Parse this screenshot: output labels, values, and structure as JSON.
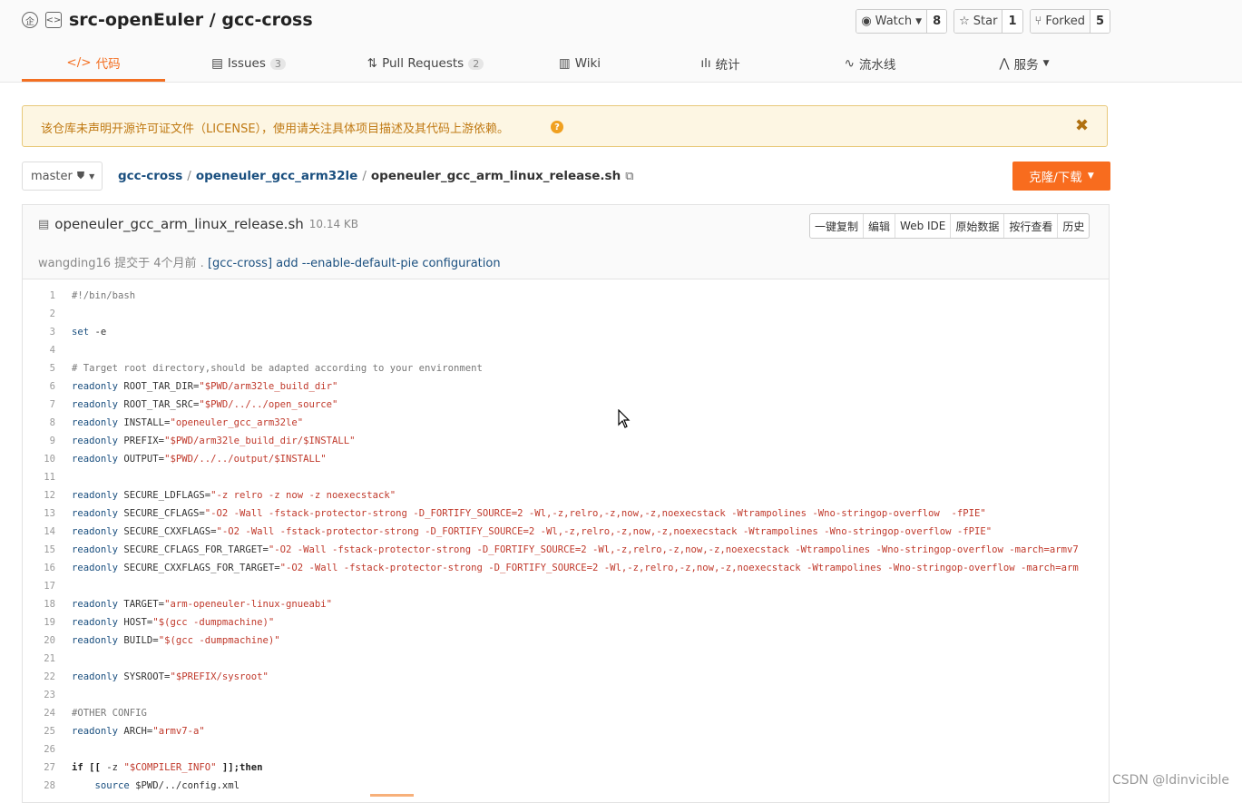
{
  "repo": {
    "title": "src-openEuler / gcc-cross",
    "watch_label": "Watch",
    "watch_count": "8",
    "star_label": "Star",
    "star_count": "1",
    "fork_label": "Forked",
    "fork_count": "5"
  },
  "tabs": [
    {
      "label": "代码",
      "icon": "code-icon"
    },
    {
      "label": "Issues",
      "count": "3",
      "icon": "issues-icon"
    },
    {
      "label": "Pull Requests",
      "count": "2",
      "icon": "pull-request-icon"
    },
    {
      "label": "Wiki",
      "icon": "wiki-icon"
    },
    {
      "label": "统计",
      "icon": "stats-icon"
    },
    {
      "label": "流水线",
      "icon": "pipeline-icon"
    },
    {
      "label": "服务",
      "icon": "service-icon"
    }
  ],
  "notice": {
    "text": "该仓库未声明开源许可证文件（LICENSE），使用请关注具体项目描述及其代码上游依赖。",
    "close": "✖"
  },
  "branch": "master",
  "breadcrumb": {
    "root": "gcc-cross",
    "dir": "openeuler_gcc_arm32le",
    "file": "openeuler_gcc_arm_linux_release.sh"
  },
  "clone_label": "克隆/下载",
  "file": {
    "name": "openeuler_gcc_arm_linux_release.sh",
    "size": "10.14 KB",
    "actions": [
      "一键复制",
      "编辑",
      "Web IDE",
      "原始数据",
      "按行查看",
      "历史"
    ],
    "commit_author": "wangding16 提交于 4个月前 .",
    "commit_msg": "[gcc-cross] add --enable-default-pie configuration"
  },
  "code": [
    "#!/bin/bash",
    "",
    "set -e",
    "",
    "# Target root directory,should be adapted according to your environment",
    "readonly ROOT_TAR_DIR=\"$PWD/arm32le_build_dir\"",
    "readonly ROOT_TAR_SRC=\"$PWD/../../open_source\"",
    "readonly INSTALL=\"openeuler_gcc_arm32le\"",
    "readonly PREFIX=\"$PWD/arm32le_build_dir/$INSTALL\"",
    "readonly OUTPUT=\"$PWD/../../output/$INSTALL\"",
    "",
    "readonly SECURE_LDFLAGS=\"-z relro -z now -z noexecstack\"",
    "readonly SECURE_CFLAGS=\"-O2 -Wall -fstack-protector-strong -D_FORTIFY_SOURCE=2 -Wl,-z,relro,-z,now,-z,noexecstack -Wtrampolines -Wno-stringop-overflow  -fPIE\"",
    "readonly SECURE_CXXFLAGS=\"-O2 -Wall -fstack-protector-strong -D_FORTIFY_SOURCE=2 -Wl,-z,relro,-z,now,-z,noexecstack -Wtrampolines -Wno-stringop-overflow -fPIE\"",
    "readonly SECURE_CFLAGS_FOR_TARGET=\"-O2 -Wall -fstack-protector-strong -D_FORTIFY_SOURCE=2 -Wl,-z,relro,-z,now,-z,noexecstack -Wtrampolines -Wno-stringop-overflow -march=armv7",
    "readonly SECURE_CXXFLAGS_FOR_TARGET=\"-O2 -Wall -fstack-protector-strong -D_FORTIFY_SOURCE=2 -Wl,-z,relro,-z,now,-z,noexecstack -Wtrampolines -Wno-stringop-overflow -march=arm",
    "",
    "readonly TARGET=\"arm-openeuler-linux-gnueabi\"",
    "readonly HOST=\"$(gcc -dumpmachine)\"",
    "readonly BUILD=\"$(gcc -dumpmachine)\"",
    "",
    "readonly SYSROOT=\"$PREFIX/sysroot\"",
    "",
    "#OTHER CONFIG",
    "readonly ARCH=\"armv7-a\"",
    "",
    "if [[ -z \"$COMPILER_INFO\" ]];then",
    "    source $PWD/../config.xml"
  ],
  "watermark": "CSDN @ldinvicible"
}
